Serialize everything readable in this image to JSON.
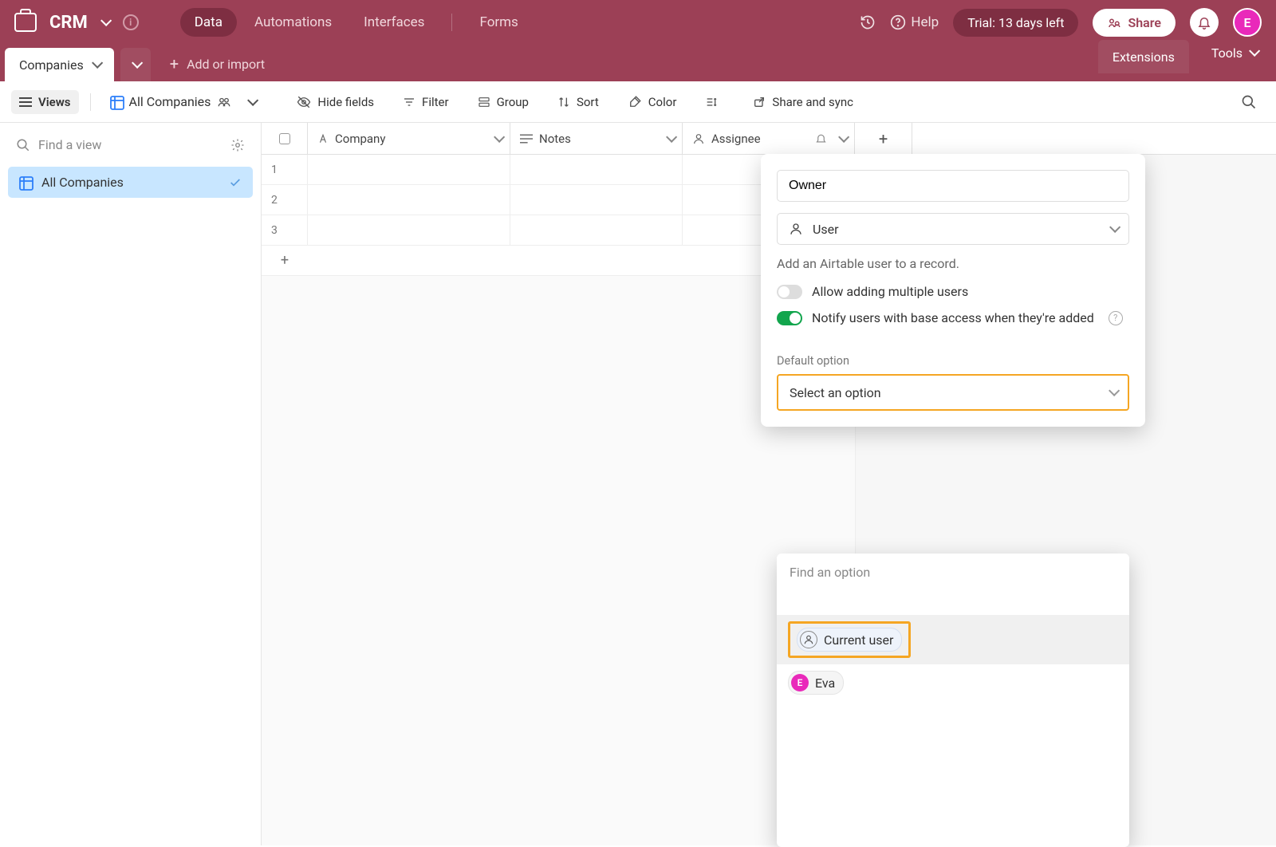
{
  "header": {
    "app_name": "CRM",
    "nav": {
      "data": "Data",
      "automations": "Automations",
      "interfaces": "Interfaces",
      "forms": "Forms"
    },
    "help": "Help",
    "trial": "Trial: 13 days left",
    "share": "Share",
    "avatar_initial": "E"
  },
  "second": {
    "table_tab": "Companies",
    "add_import": "Add or import",
    "extensions": "Extensions",
    "tools": "Tools"
  },
  "toolbar": {
    "views": "Views",
    "current_view": "All Companies",
    "hide_fields": "Hide fields",
    "filter": "Filter",
    "group": "Group",
    "sort": "Sort",
    "color": "Color",
    "share_sync": "Share and sync"
  },
  "sidebar": {
    "find_placeholder": "Find a view",
    "views": [
      {
        "label": "All Companies"
      }
    ]
  },
  "columns": {
    "company": "Company",
    "notes": "Notes",
    "assignee": "Assignee"
  },
  "rows": [
    "1",
    "2",
    "3"
  ],
  "field_menu": {
    "name_value": "Owner",
    "type_label": "User",
    "description": "Add an Airtable user to a record.",
    "allow_multi_label": "Allow adding multiple users",
    "allow_multi": false,
    "notify_label": "Notify users with base access when they're added",
    "notify": true,
    "default_label": "Default option",
    "default_placeholder": "Select an option"
  },
  "option_dropdown": {
    "search_placeholder": "Find an option",
    "options": [
      {
        "type": "current",
        "label": "Current user"
      },
      {
        "type": "user",
        "label": "Eva",
        "initial": "E"
      }
    ]
  }
}
